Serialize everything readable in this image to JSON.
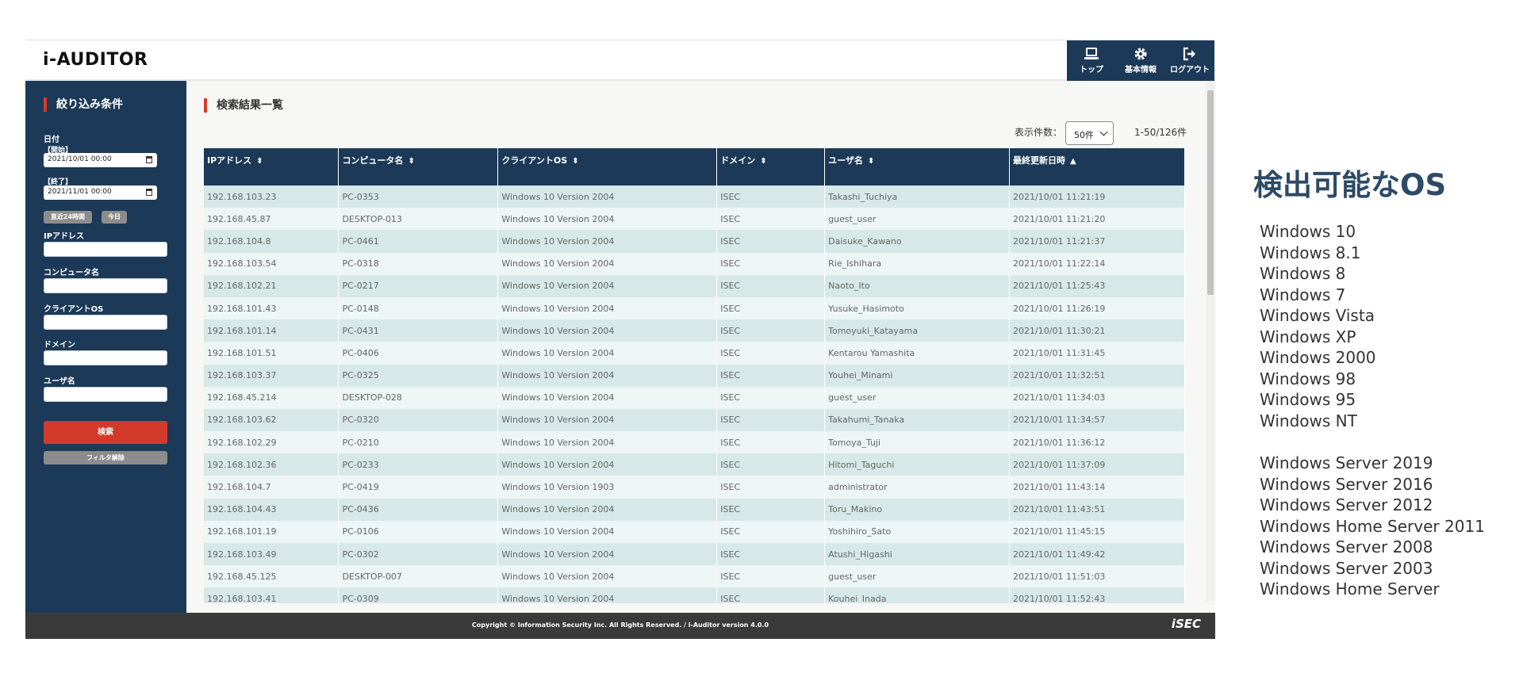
{
  "header": {
    "logo": "i-AUDITOR",
    "buttons": [
      {
        "label": "トップ",
        "icon": "top-icon"
      },
      {
        "label": "基本情報",
        "icon": "gear-icon"
      },
      {
        "label": "ログアウト",
        "icon": "logout-icon"
      }
    ]
  },
  "sidebar": {
    "title": "絞り込み条件",
    "date_label": "日付",
    "start_label": "【開始】",
    "start_value": "2021/10/01 00:00",
    "end_label": "【終了】",
    "end_value": "2021/11/01 00:00",
    "recent_button": "直近24時間",
    "today_button": "今日",
    "ip_label": "IPアドレス",
    "computer_label": "コンピュータ名",
    "os_label": "クライアントOS",
    "domain_label": "ドメイン",
    "user_label": "ユーザ名",
    "search_button": "検索",
    "clear_button": "フィルタ解除"
  },
  "main": {
    "title": "検索結果一覧",
    "per_page_label": "表示件数：",
    "per_page_value": "50件",
    "range": "1-50/126件",
    "columns": [
      {
        "label": "IPアドレス",
        "sort": "⬍"
      },
      {
        "label": "コンピュータ名",
        "sort": "⬍"
      },
      {
        "label": "クライアントOS",
        "sort": "⬍"
      },
      {
        "label": "ドメイン",
        "sort": "⬍"
      },
      {
        "label": "ユーザ名",
        "sort": "⬍"
      },
      {
        "label": "最終更新日時",
        "sort": "▲"
      }
    ],
    "rows": [
      [
        "192.168.103.23",
        "PC-0353",
        "Windows 10 Version 2004",
        "ISEC",
        "Takashi_Tuchiya",
        "2021/10/01 11:21:19"
      ],
      [
        "192.168.45.87",
        "DESKTOP-013",
        "Windows 10 Version 2004",
        "ISEC",
        "guest_user",
        "2021/10/01 11:21:20"
      ],
      [
        "192.168.104.8",
        "PC-0461",
        "Windows 10 Version 2004",
        "ISEC",
        "Daisuke_Kawano",
        "2021/10/01 11:21:37"
      ],
      [
        "192.168.103.54",
        "PC-0318",
        "Windows 10 Version 2004",
        "ISEC",
        "Rie_Ishihara",
        "2021/10/01 11:22:14"
      ],
      [
        "192.168.102.21",
        "PC-0217",
        "Windows 10 Version 2004",
        "ISEC",
        "Naoto_Ito",
        "2021/10/01 11:25:43"
      ],
      [
        "192.168.101.43",
        "PC-0148",
        "Windows 10 Version 2004",
        "ISEC",
        "Yusuke_Hasimoto",
        "2021/10/01 11:26:19"
      ],
      [
        "192.168.101.14",
        "PC-0431",
        "Windows 10 Version 2004",
        "ISEC",
        "Tomoyuki_Katayama",
        "2021/10/01 11:30:21"
      ],
      [
        "192.168.101.51",
        "PC-0406",
        "Windows 10 Version 2004",
        "ISEC",
        "Kentarou Yamashita",
        "2021/10/01 11:31:45"
      ],
      [
        "192.168.103.37",
        "PC-0325",
        "Windows 10 Version 2004",
        "ISEC",
        "Youhei_Minami",
        "2021/10/01 11:32:51"
      ],
      [
        "192.168.45.214",
        "DESKTOP-028",
        "Windows 10 Version 2004",
        "ISEC",
        "guest_user",
        "2021/10/01 11:34:03"
      ],
      [
        "192.168.103.62",
        "PC-0320",
        "Windows 10 Version 2004",
        "ISEC",
        "Takahumi_Tanaka",
        "2021/10/01 11:34:57"
      ],
      [
        "192.168.102.29",
        "PC-0210",
        "Windows 10 Version 2004",
        "ISEC",
        "Tomoya_Tuji",
        "2021/10/01 11:36:12"
      ],
      [
        "192.168.102.36",
        "PC-0233",
        "Windows 10 Version 2004",
        "ISEC",
        "Hitomi_Taguchi",
        "2021/10/01 11:37:09"
      ],
      [
        "192.168.104.7",
        "PC-0419",
        "Windows 10 Version 1903",
        "ISEC",
        "administrator",
        "2021/10/01 11:43:14"
      ],
      [
        "192.168.104.43",
        "PC-0436",
        "Windows 10 Version 2004",
        "ISEC",
        "Toru_Makino",
        "2021/10/01 11:43:51"
      ],
      [
        "192.168.101.19",
        "PC-0106",
        "Windows 10 Version 2004",
        "ISEC",
        "Yoshihiro_Sato",
        "2021/10/01 11:45:15"
      ],
      [
        "192.168.103.49",
        "PC-0302",
        "Windows 10 Version 2004",
        "ISEC",
        "Atushi_Higashi",
        "2021/10/01 11:49:42"
      ],
      [
        "192.168.45.125",
        "DESKTOP-007",
        "Windows 10 Version 2004",
        "ISEC",
        "guest_user",
        "2021/10/01 11:51:03"
      ],
      [
        "192.168.103.41",
        "PC-0309",
        "Windows 10 Version 2004",
        "ISEC",
        "Kouhei_Inada",
        "2021/10/01 11:52:43"
      ]
    ]
  },
  "footer": {
    "copyright": "Copyright © Information Security Inc. All Rights Reserved. / i-Auditor version 4.0.0",
    "logo": "iSEC"
  },
  "os_panel": {
    "title": "検出可能なOS",
    "items": [
      "Windows 10",
      "Windows 8.1",
      "Windows 8",
      "Windows 7",
      "Windows Vista",
      "Windows XP",
      "Windows 2000",
      "Windows 98",
      "Windows 95",
      "Windows NT",
      "Windows Server 2019",
      "Windows Server 2016",
      "Windows Server 2012",
      "Windows Home Server 2011",
      "Windows Server 2008",
      "Windows Server 2003",
      "Windows Home Server"
    ]
  },
  "colors": {
    "navy": "#1c3a57",
    "accent_red": "#d23a2c",
    "row_odd": "#d6e8e8",
    "row_even": "#eef5f5"
  }
}
